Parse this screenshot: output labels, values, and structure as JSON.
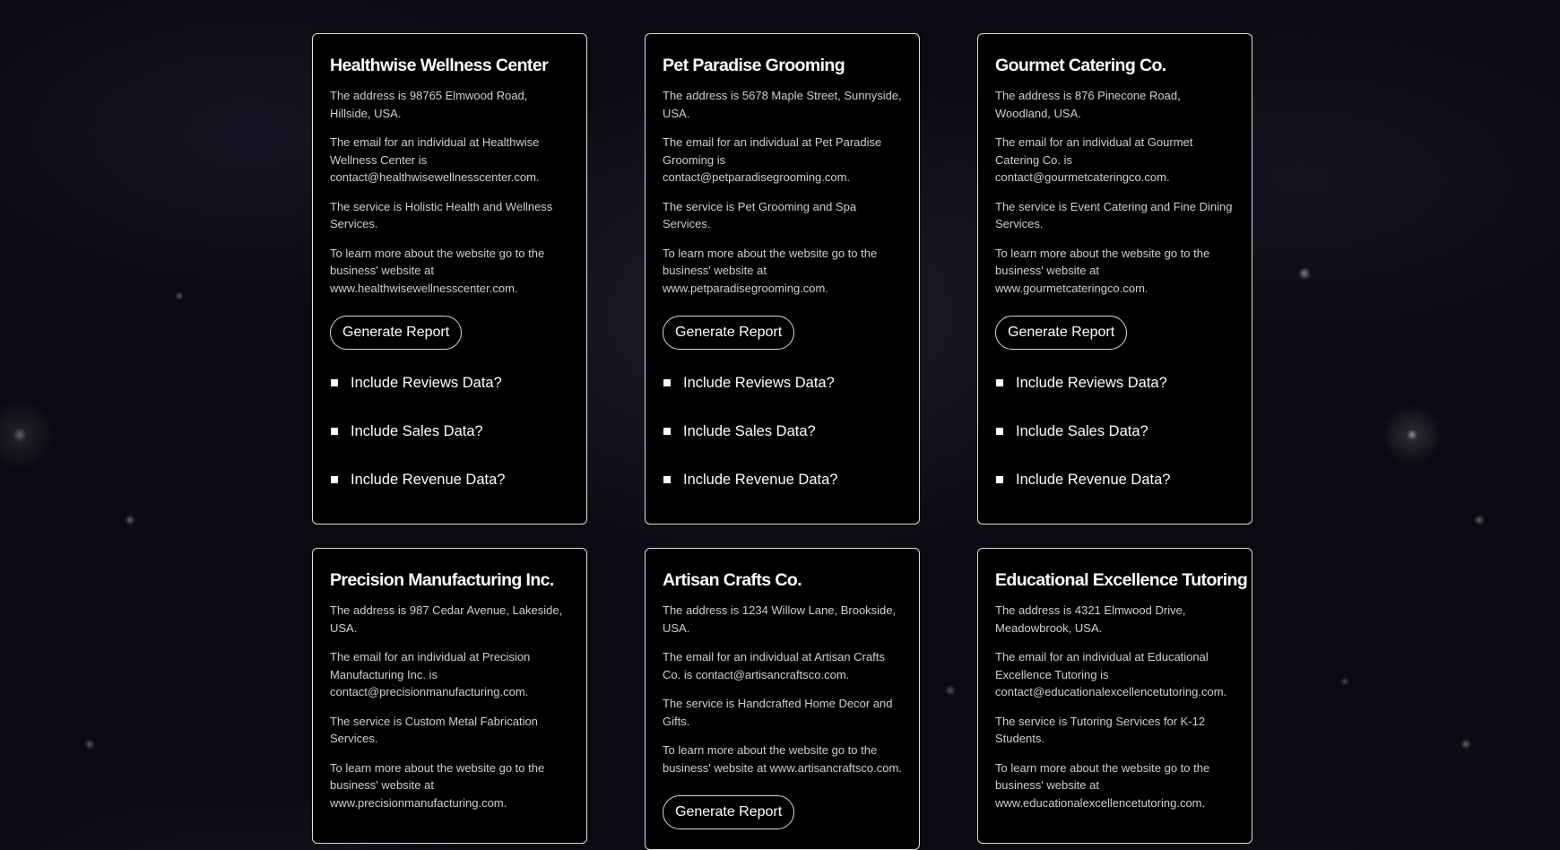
{
  "cards": [
    {
      "title": "Healthwise Wellness Center",
      "address": "The address is 98765 Elmwood Road, Hillside, USA.",
      "email": "The email for an individual at Healthwise Wellness Center is contact@healthwisewellnesscenter.com.",
      "service": "The service is Holistic Health and Wellness Services.",
      "website": "To learn more about the website go to the business' website at www.healthwisewellnesscenter.com.",
      "button_label": "Generate Report",
      "checkboxes": [
        "Include Reviews Data?",
        "Include Sales Data?",
        "Include Revenue Data?"
      ]
    },
    {
      "title": "Pet Paradise Grooming",
      "address": "The address is 5678 Maple Street, Sunnyside, USA.",
      "email": "The email for an individual at Pet Paradise Grooming is contact@petparadisegrooming.com.",
      "service": "The service is Pet Grooming and Spa Services.",
      "website": "To learn more about the website go to the business' website at www.petparadisegrooming.com.",
      "button_label": "Generate Report",
      "checkboxes": [
        "Include Reviews Data?",
        "Include Sales Data?",
        "Include Revenue Data?"
      ]
    },
    {
      "title": "Gourmet Catering Co.",
      "address": "The address is 876 Pinecone Road, Woodland, USA.",
      "email": "The email for an individual at Gourmet Catering Co. is contact@gourmetcateringco.com.",
      "service": "The service is Event Catering and Fine Dining Services.",
      "website": "To learn more about the website go to the business' website at www.gourmetcateringco.com.",
      "button_label": "Generate Report",
      "checkboxes": [
        "Include Reviews Data?",
        "Include Sales Data?",
        "Include Revenue Data?"
      ]
    },
    {
      "title": "Precision Manufacturing Inc.",
      "address": "The address is 987 Cedar Avenue, Lakeside, USA.",
      "email": "The email for an individual at Precision Manufacturing Inc. is contact@precisionmanufacturing.com.",
      "service": "The service is Custom Metal Fabrication Services.",
      "website": "To learn more about the website go to the business' website at www.precisionmanufacturing.com."
    },
    {
      "title": "Artisan Crafts Co.",
      "address": "The address is 1234 Willow Lane, Brookside, USA.",
      "email": "The email for an individual at Artisan Crafts Co. is contact@artisancraftsco.com.",
      "service": "The service is Handcrafted Home Decor and Gifts.",
      "website": "To learn more about the website go to the business' website at www.artisancraftsco.com.",
      "button_label": "Generate Report"
    },
    {
      "title": "Educational Excellence Tutoring",
      "address": "The address is 4321 Elmwood Drive, Meadowbrook, USA.",
      "email": "The email for an individual at Educational Excellence Tutoring is contact@educationalexcellencetutoring.com.",
      "service": "The service is Tutoring Services for K-12 Students.",
      "website": "To learn more about the website go to the business' website at www.educationalexcellencetutoring.com."
    }
  ]
}
